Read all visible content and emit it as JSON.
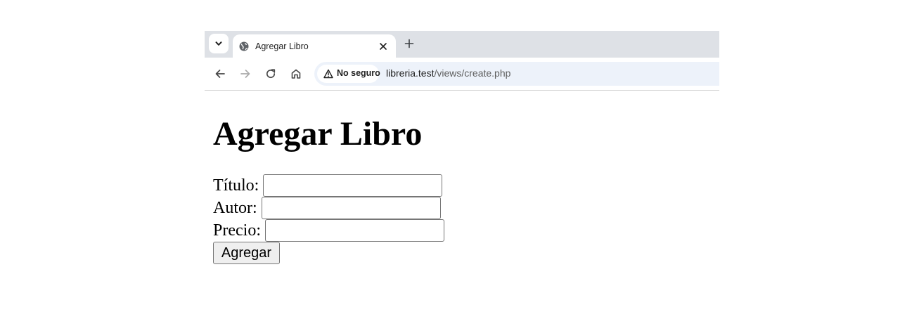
{
  "browser": {
    "tab": {
      "title": "Agregar Libro",
      "favicon": "globe-icon"
    },
    "security_label": "No seguro",
    "url": {
      "host": "libreria.test",
      "path": "/views/create.php"
    },
    "icons": [
      "chevron-down-icon",
      "close-icon",
      "plus-icon",
      "back-arrow-icon",
      "forward-arrow-icon",
      "reload-icon",
      "home-icon",
      "warning-icon"
    ]
  },
  "page": {
    "heading": "Agregar Libro",
    "form": {
      "titulo_label": "Título:",
      "titulo_value": "",
      "autor_label": "Autor:",
      "autor_value": "",
      "precio_label": "Precio:",
      "precio_value": "",
      "submit_label": "Agregar"
    }
  }
}
